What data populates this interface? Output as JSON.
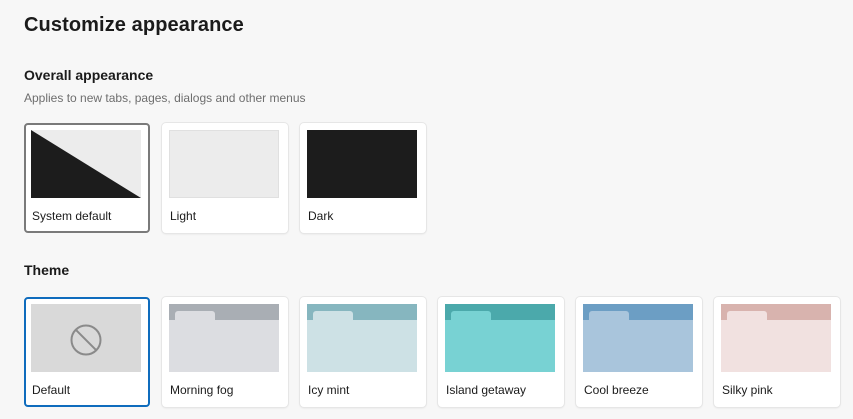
{
  "page": {
    "title": "Customize appearance"
  },
  "overall": {
    "title": "Overall appearance",
    "subtitle": "Applies to new tabs, pages, dialogs and other menus",
    "options": [
      {
        "label": "System default",
        "selected": true
      },
      {
        "label": "Light",
        "selected": false
      },
      {
        "label": "Dark",
        "selected": false
      }
    ]
  },
  "theme": {
    "title": "Theme",
    "options": [
      {
        "label": "Default",
        "selected": true,
        "icon": "no-theme-icon"
      },
      {
        "label": "Morning fog",
        "selected": false,
        "colors": {
          "bar": "#a9aeb4",
          "tab": "#dcdde1",
          "body": "#dcdde1"
        }
      },
      {
        "label": "Icy mint",
        "selected": false,
        "colors": {
          "bar": "#86b6bf",
          "tab": "#cde1e5",
          "body": "#cde1e5"
        }
      },
      {
        "label": "Island getaway",
        "selected": false,
        "colors": {
          "bar": "#4ba9ab",
          "tab": "#78d2d3",
          "body": "#78d2d3"
        }
      },
      {
        "label": "Cool breeze",
        "selected": false,
        "colors": {
          "bar": "#6c9ec4",
          "tab": "#a9c5dc",
          "body": "#a9c5dc"
        }
      },
      {
        "label": "Silky pink",
        "selected": false,
        "colors": {
          "bar": "#d8b3ae",
          "tab": "#f1e1e0",
          "body": "#f1e1e0"
        }
      }
    ]
  },
  "colors": {
    "accent": "#0f6cbd",
    "selected_gray": "#7a7a7a",
    "dark_preview": "#1c1c1c",
    "light_preview": "#ececec"
  }
}
